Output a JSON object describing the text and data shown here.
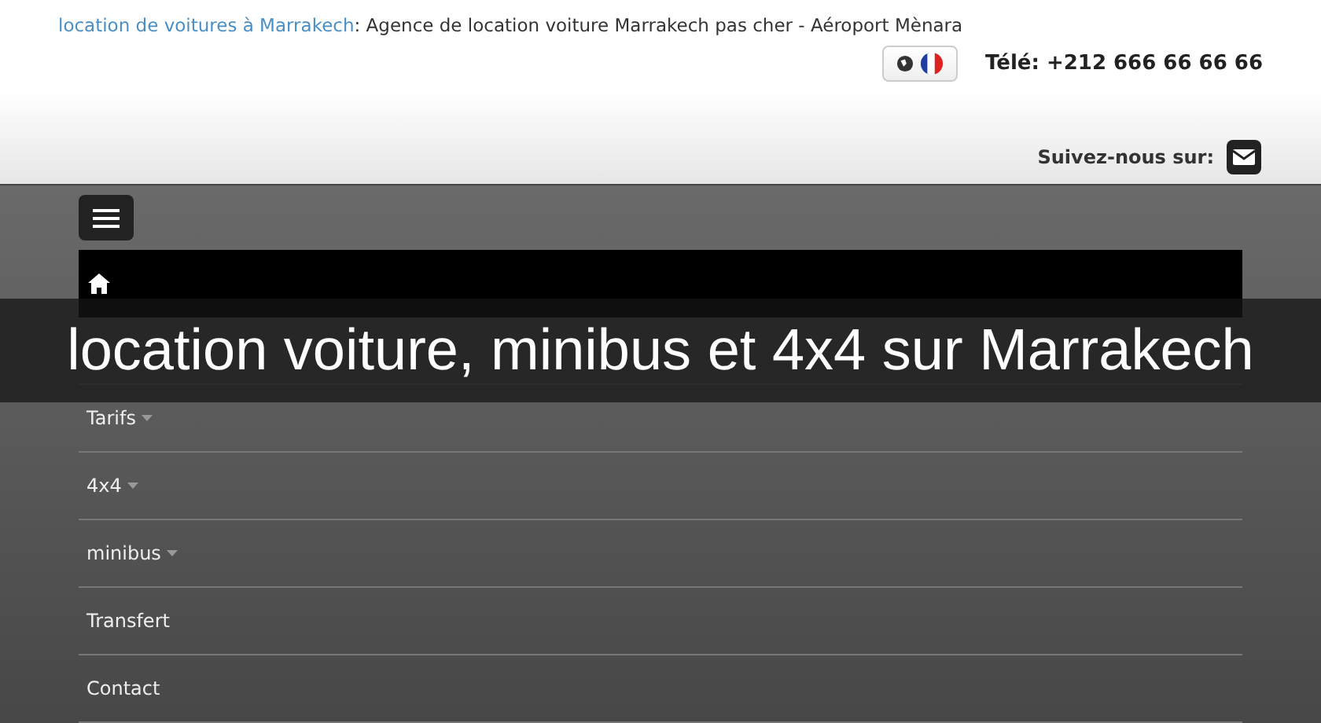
{
  "header": {
    "site_link": "location de voitures à Marrakech",
    "tagline": ": Agence de location voiture Marrakech pas cher - Aéroport Mènara",
    "phone": "Télé: +212 666 66 66 66",
    "follow": "Suivez-nous sur:"
  },
  "menu": [
    {
      "label": "Tarifs",
      "kind": "dropdown"
    },
    {
      "label": "4x4",
      "kind": "dropdown"
    },
    {
      "label": "minibus",
      "kind": "dropdown"
    },
    {
      "label": "Transfert",
      "kind": "link"
    },
    {
      "label": "Contact",
      "kind": "link"
    }
  ],
  "banner": {
    "title": "location voiture, minibus et 4x4 sur Marrakech"
  }
}
